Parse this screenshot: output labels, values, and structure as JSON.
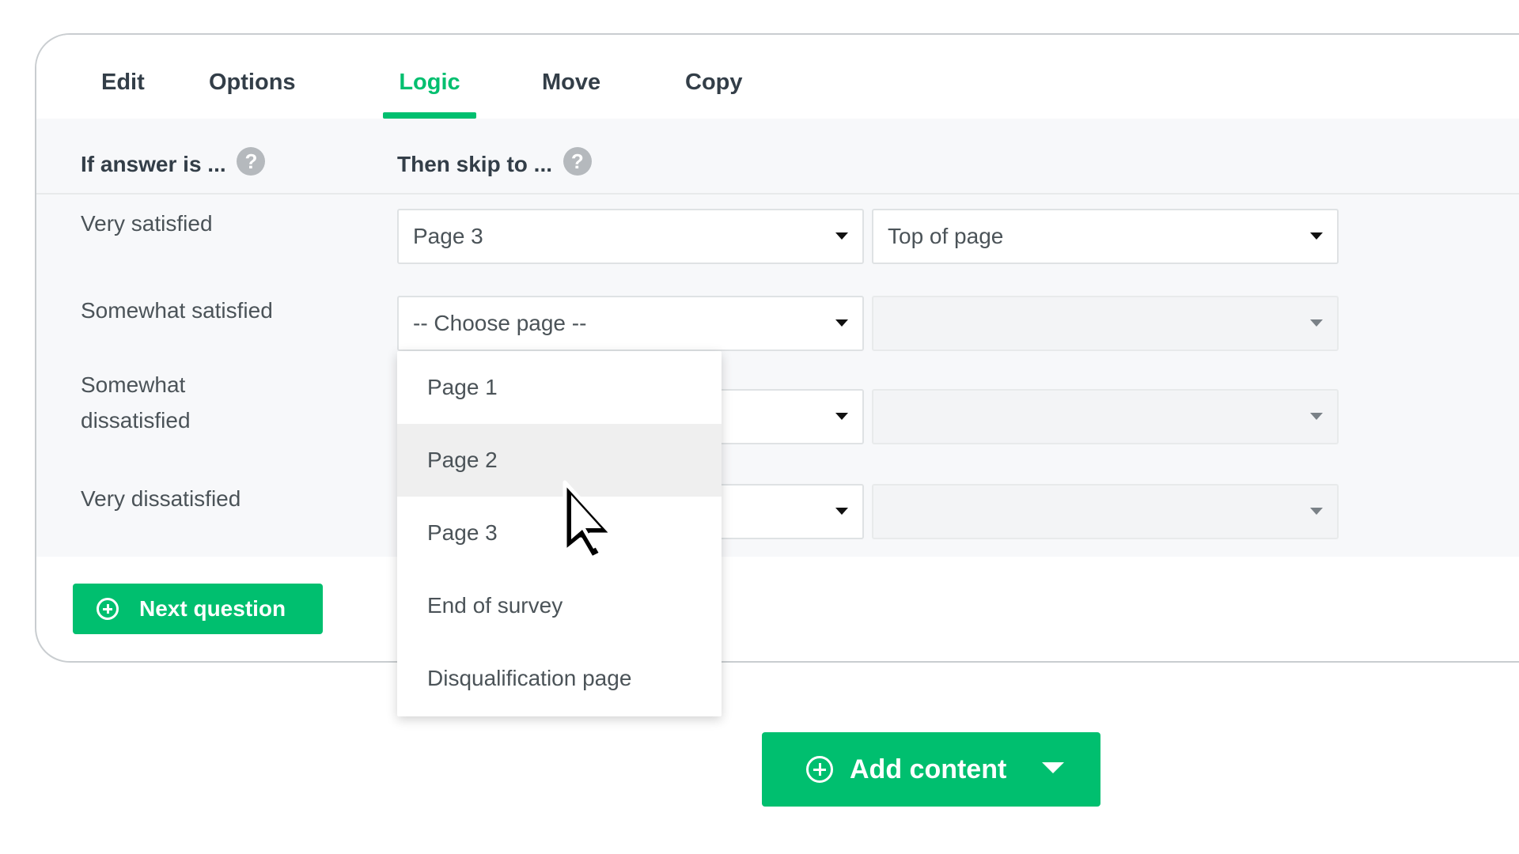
{
  "tabs": [
    {
      "label": "Edit",
      "active": false
    },
    {
      "label": "Options",
      "active": false
    },
    {
      "label": "Logic",
      "active": true
    },
    {
      "label": "Move",
      "active": false
    },
    {
      "label": "Copy",
      "active": false
    }
  ],
  "logic": {
    "answer_header": "If answer is ...",
    "skip_header": "Then skip to ...",
    "rows": [
      {
        "answer": "Very satisfied",
        "page_value": "Page 3",
        "position_value": "Top of page"
      },
      {
        "answer": "Somewhat satisfied",
        "page_value": "-- Choose page --",
        "position_value": ""
      },
      {
        "answer": "Somewhat dissatisfied",
        "page_value": "",
        "position_value": ""
      },
      {
        "answer": "Very dissatisfied",
        "page_value": "",
        "position_value": ""
      }
    ]
  },
  "dropdown": {
    "options": [
      "Page 1",
      "Page 2",
      "Page 3",
      "End of survey",
      "Disqualification page"
    ],
    "hovered": "Page 2"
  },
  "next_question_label": "Next question",
  "add_content_label": "Add content",
  "colors": {
    "accent": "#00bf6f",
    "text": "#333e48",
    "panel": "#f7f8fa"
  },
  "icons": {
    "help": "question-circle-icon",
    "caret": "caret-down-icon",
    "add": "plus-circle-icon",
    "cursor": "mouse-pointer-icon"
  }
}
